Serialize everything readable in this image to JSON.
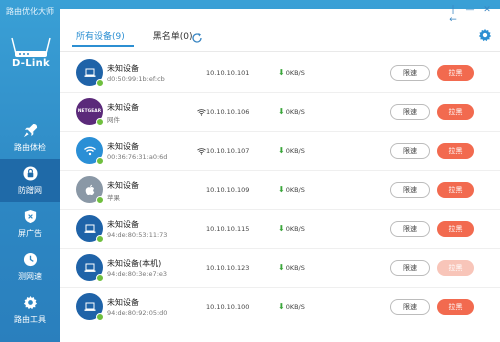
{
  "app": {
    "title": "路由优化大师",
    "brand": "D-Link"
  },
  "sidebar": {
    "items": [
      {
        "label": "路由体检",
        "icon": "rocket-icon",
        "active": false
      },
      {
        "label": "防蹭网",
        "icon": "lock-icon",
        "active": true
      },
      {
        "label": "屏广告",
        "icon": "shield-icon",
        "active": false
      },
      {
        "label": "测网速",
        "icon": "clock-icon",
        "active": false
      },
      {
        "label": "路由工具",
        "icon": "gear-icon",
        "active": false
      }
    ]
  },
  "window_controls": {
    "pin": "|←",
    "minimize": "—",
    "close": "✕"
  },
  "tabs": [
    {
      "label": "所有设备(9)",
      "active": true
    },
    {
      "label": "黑名单(0)",
      "active": false
    }
  ],
  "labels": {
    "limit": "限速",
    "block": "拉黑"
  },
  "devices": [
    {
      "name": "未知设备",
      "sub": "d0:50:99:1b:ef:cb",
      "avatar": "laptop-icon",
      "wifi": false,
      "ip": "10.10.10.101",
      "speed": "0KB/S",
      "block_enabled": true
    },
    {
      "name": "未知设备",
      "sub": "网件",
      "avatar": "netgear-logo",
      "avatar_text": "NETGEAR",
      "wifi": true,
      "ip": "10.10.10.106",
      "speed": "0KB/S",
      "block_enabled": true
    },
    {
      "name": "未知设备",
      "sub": "00:36:76:31:a0:6d",
      "avatar": "wifi-icon",
      "wifi": true,
      "ip": "10.10.10.107",
      "speed": "0KB/S",
      "block_enabled": true
    },
    {
      "name": "未知设备",
      "sub": "苹果",
      "avatar": "apple-icon",
      "wifi": false,
      "ip": "10.10.10.109",
      "speed": "0KB/S",
      "block_enabled": true
    },
    {
      "name": "未知设备",
      "sub": "94:de:80:53:11:73",
      "avatar": "laptop-icon",
      "wifi": false,
      "ip": "10.10.10.115",
      "speed": "0KB/S",
      "block_enabled": true
    },
    {
      "name": "未知设备(本机)",
      "sub": "94:de:80:3e:e7:e3",
      "avatar": "laptop-icon",
      "wifi": false,
      "ip": "10.10.10.123",
      "speed": "0KB/S",
      "block_enabled": false
    },
    {
      "name": "未知设备",
      "sub": "94:de:80:92:05:d0",
      "avatar": "laptop-icon",
      "wifi": false,
      "ip": "10.10.10.100",
      "speed": "0KB/S",
      "block_enabled": true
    }
  ],
  "colors": {
    "accent": "#2c8fd2",
    "sidebar": "#2d87c3",
    "block": "#f26a4f",
    "online": "#6fbf3e"
  }
}
